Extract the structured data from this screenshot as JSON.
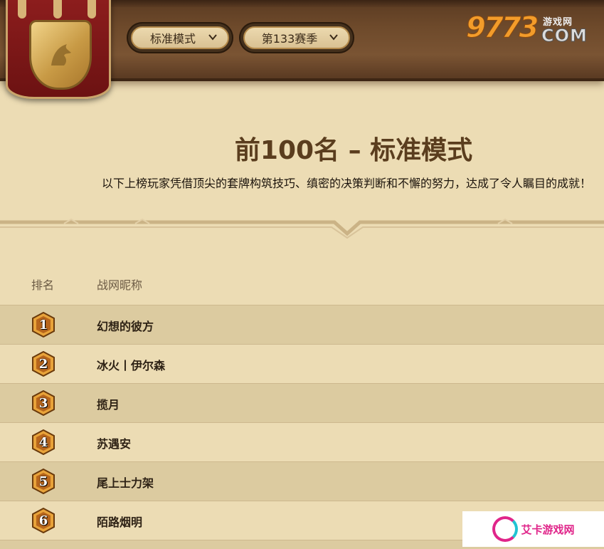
{
  "header": {
    "mode_select": {
      "value": "标准模式"
    },
    "season_select": {
      "value": "第133赛季"
    },
    "site_logo": {
      "digits": "9773",
      "cn_text": "游戏网",
      "suffix": "COM"
    }
  },
  "main": {
    "title": "前100名 – 标准模式",
    "subtitle": "以下上榜玩家凭借顶尖的套牌构筑技巧、缜密的决策判断和不懈的努力，达成了令人瞩目的成就！"
  },
  "table": {
    "columns": {
      "rank": "排名",
      "name": "战网昵称"
    },
    "rows": [
      {
        "rank": "1",
        "name": "幻想的彼方"
      },
      {
        "rank": "2",
        "name": "冰火丨伊尔森"
      },
      {
        "rank": "3",
        "name": "揽月"
      },
      {
        "rank": "4",
        "name": "苏遇安"
      },
      {
        "rank": "5",
        "name": "尾上士力架"
      },
      {
        "rank": "6",
        "name": "陌路烟明"
      }
    ]
  },
  "watermark": {
    "text": "艾卡游戏网"
  },
  "colors": {
    "page_bg": "#ecdcb4",
    "row_alt_bg": "#dccba0",
    "wood": "#6e4a2b",
    "banner_red": "#8c1d1d",
    "medal_gold": "#e8a33a"
  }
}
